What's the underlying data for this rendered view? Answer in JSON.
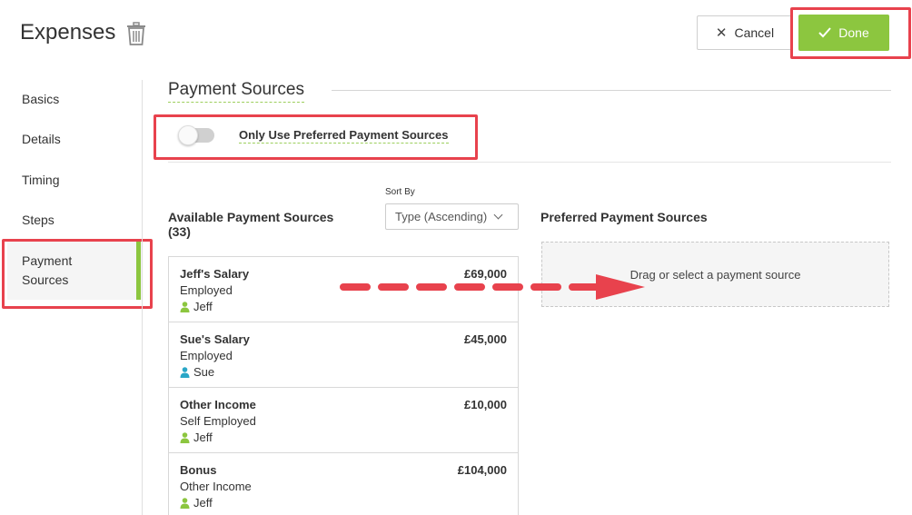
{
  "header": {
    "title": "Expenses",
    "cancel_label": "Cancel",
    "done_label": "Done"
  },
  "sidebar": {
    "items": [
      {
        "label": "Basics"
      },
      {
        "label": "Details"
      },
      {
        "label": "Timing"
      },
      {
        "label": "Steps"
      },
      {
        "label": "Payment Sources",
        "active": true
      }
    ]
  },
  "section": {
    "title": "Payment Sources",
    "toggle_label": "Only Use Preferred Payment Sources",
    "toggle_on": false
  },
  "available": {
    "title": "Available Payment Sources (33)",
    "sort_label": "Sort By",
    "sort_value": "Type (Ascending)",
    "items": [
      {
        "name": "Jeff's Salary",
        "type": "Employed",
        "owner": "Jeff",
        "owner_color": "#8cc63f",
        "amount": "£69,000"
      },
      {
        "name": "Sue's Salary",
        "type": "Employed",
        "owner": "Sue",
        "owner_color": "#2aa7c7",
        "amount": "£45,000"
      },
      {
        "name": "Other Income",
        "type": "Self Employed",
        "owner": "Jeff",
        "owner_color": "#8cc63f",
        "amount": "£10,000"
      },
      {
        "name": "Bonus",
        "type": "Other Income",
        "owner": "Jeff",
        "owner_color": "#8cc63f",
        "amount": "£104,000"
      }
    ]
  },
  "preferred": {
    "title": "Preferred Payment Sources",
    "drop_text": "Drag or select a payment source"
  },
  "colors": {
    "accent": "#8cc63f",
    "highlight": "#e8424d"
  }
}
